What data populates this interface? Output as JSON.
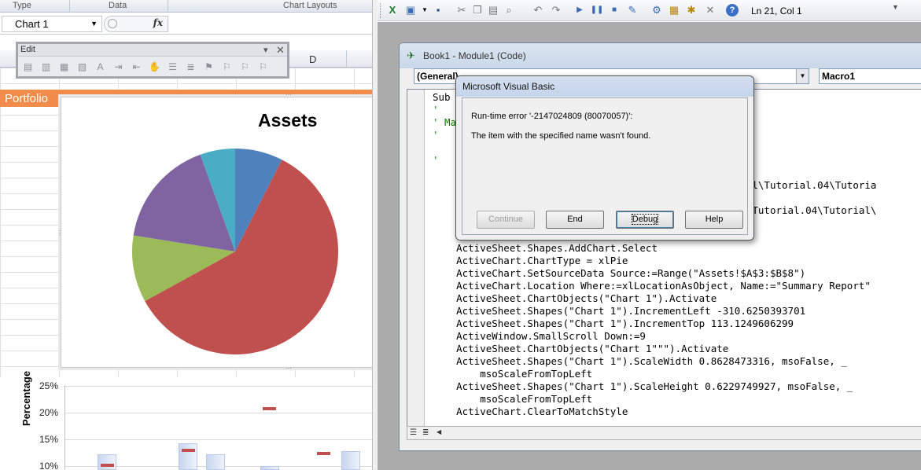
{
  "excel": {
    "ribbon_groups": [
      "Type",
      "Data",
      "Chart Layouts"
    ],
    "name_box": "Chart 1",
    "fx_label": "fx",
    "edit_toolbar_title": "Edit",
    "column_header": "D",
    "portfolio_header": "Portfolio",
    "pie_chart_title": "Assets",
    "bar_chart": {
      "ylabel": "Percentage",
      "ticks": [
        "25%",
        "20%",
        "15%",
        "10%"
      ]
    }
  },
  "chart_data": [
    {
      "type": "pie",
      "title": "Assets",
      "categories": [
        "",
        "",
        "",
        "",
        ""
      ],
      "values": [
        0.075,
        0.595,
        0.105,
        0.17,
        0.055
      ],
      "colors": [
        "#4f81bd",
        "#c0504d",
        "#9bbb59",
        "#8064a2",
        "#4bacc6"
      ]
    },
    {
      "type": "bar",
      "title": "",
      "ylabel": "Percentage",
      "ylim": [
        0.1,
        0.25
      ],
      "tick_labels": [
        "25%",
        "20%",
        "15%",
        "10%"
      ]
    }
  ],
  "vbe": {
    "toolbar_position": "Ln 21, Col 1",
    "code_window_title": "Book1 - Module1 (Code)",
    "object_combo": "(General)",
    "procedure_combo": "Macro1",
    "code_lines": [
      {
        "text": "Sub ",
        "type": "code"
      },
      {
        "text": "'",
        "type": "comment"
      },
      {
        "text": "' Ma",
        "type": "comment"
      },
      {
        "text": "'",
        "type": "comment"
      },
      {
        "text": "",
        "type": "code"
      },
      {
        "text": "'",
        "type": "comment"
      },
      {
        "text": "",
        "type": "code"
      },
      {
        "text": "                                                s_Excel\\Tutorial.04\\Tutoria",
        "type": "code"
      },
      {
        "text": "",
        "type": "code"
      },
      {
        "text": "                                                Excel\\Tutorial.04\\Tutorial\\",
        "type": "code"
      },
      {
        "text": "",
        "type": "code"
      },
      {
        "text": "",
        "type": "code"
      },
      {
        "text": "    ActiveSheet.Shapes.AddChart.Select",
        "type": "code"
      },
      {
        "text": "    ActiveChart.ChartType = xlPie",
        "type": "code"
      },
      {
        "text": "    ActiveChart.SetSourceData Source:=Range(\"Assets!$A$3:$B$8\")",
        "type": "code"
      },
      {
        "text": "    ActiveChart.Location Where:=xlLocationAsObject, Name:=\"Summary Report\"",
        "type": "code"
      },
      {
        "text": "    ActiveSheet.ChartObjects(\"Chart 1\").Activate",
        "type": "code"
      },
      {
        "text": "    ActiveSheet.Shapes(\"Chart 1\").IncrementLeft -310.6250393701",
        "type": "code"
      },
      {
        "text": "    ActiveSheet.Shapes(\"Chart 1\").IncrementTop 113.1249606299",
        "type": "code"
      },
      {
        "text": "    ActiveWindow.SmallScroll Down:=9",
        "type": "code"
      },
      {
        "text": "    ActiveSheet.ChartObjects(\"Chart 1\"\"\").Activate",
        "type": "code"
      },
      {
        "text": "    ActiveSheet.Shapes(\"Chart 1\").ScaleWidth 0.8628473316, msoFalse, _",
        "type": "code"
      },
      {
        "text": "        msoScaleFromTopLeft",
        "type": "code"
      },
      {
        "text": "    ActiveSheet.Shapes(\"Chart 1\").ScaleHeight 0.6229749927, msoFalse, _",
        "type": "code"
      },
      {
        "text": "        msoScaleFromTopLeft",
        "type": "code"
      },
      {
        "text": "    ActiveChart.ClearToMatchStyle",
        "type": "code"
      }
    ]
  },
  "dialog": {
    "title": "Microsoft Visual Basic",
    "error_line": "Run-time error '-2147024809 (80070057)':",
    "message": "The item with the specified name wasn't found.",
    "buttons": {
      "continue": "Continue",
      "end": "End",
      "debug": "Debug",
      "help": "Help"
    }
  }
}
